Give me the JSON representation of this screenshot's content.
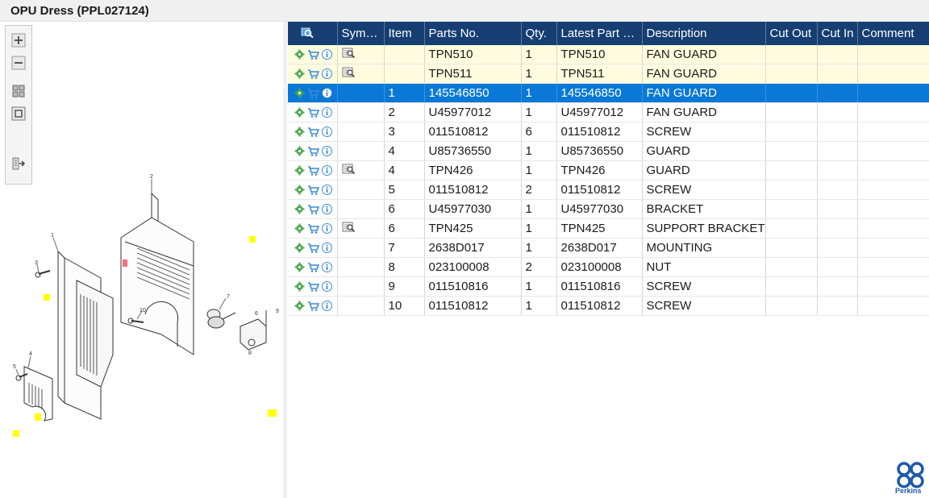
{
  "window": {
    "title": "OPU Dress (PPL027124)"
  },
  "viewer_toolbar": {
    "buttons": [
      "zoom-in-icon",
      "zoom-out-icon",
      "fit-all-icon",
      "fit-window-icon",
      "export-icon"
    ]
  },
  "colors": {
    "header_bg": "#163e72",
    "selected_row": "#0a78d6",
    "highlight_row": "#fdfcdf",
    "gear_icon": "#4aa64a",
    "cart_icon": "#3a8ad6",
    "brand": "#1e5aa8"
  },
  "table": {
    "columns": [
      "Symb…",
      "Item",
      "Parts No.",
      "Qty.",
      "Latest Part No.",
      "Description",
      "Cut Out",
      "Cut In",
      "Comment"
    ],
    "rows": [
      {
        "symbol": true,
        "item": "",
        "parts_no": "TPN510",
        "qty": "1",
        "latest": "TPN510",
        "description": "FAN GUARD",
        "cut_out": "",
        "cut_in": "",
        "comment": "",
        "state": "highlight"
      },
      {
        "symbol": true,
        "item": "",
        "parts_no": "TPN511",
        "qty": "1",
        "latest": "TPN511",
        "description": "FAN GUARD",
        "cut_out": "",
        "cut_in": "",
        "comment": "",
        "state": "highlight"
      },
      {
        "symbol": false,
        "item": "1",
        "parts_no": "145546850",
        "qty": "1",
        "latest": "145546850",
        "description": "FAN GUARD",
        "cut_out": "",
        "cut_in": "",
        "comment": "",
        "state": "selected"
      },
      {
        "symbol": false,
        "item": "2",
        "parts_no": "U45977012",
        "qty": "1",
        "latest": "U45977012",
        "description": "FAN GUARD",
        "cut_out": "",
        "cut_in": "",
        "comment": "",
        "state": "normal"
      },
      {
        "symbol": false,
        "item": "3",
        "parts_no": "011510812",
        "qty": "6",
        "latest": "011510812",
        "description": "SCREW",
        "cut_out": "",
        "cut_in": "",
        "comment": "",
        "state": "normal"
      },
      {
        "symbol": false,
        "item": "4",
        "parts_no": "U85736550",
        "qty": "1",
        "latest": "U85736550",
        "description": "GUARD",
        "cut_out": "",
        "cut_in": "",
        "comment": "",
        "state": "normal"
      },
      {
        "symbol": true,
        "item": "4",
        "parts_no": "TPN426",
        "qty": "1",
        "latest": "TPN426",
        "description": "GUARD",
        "cut_out": "",
        "cut_in": "",
        "comment": "",
        "state": "normal"
      },
      {
        "symbol": false,
        "item": "5",
        "parts_no": "011510812",
        "qty": "2",
        "latest": "011510812",
        "description": "SCREW",
        "cut_out": "",
        "cut_in": "",
        "comment": "",
        "state": "normal"
      },
      {
        "symbol": false,
        "item": "6",
        "parts_no": "U45977030",
        "qty": "1",
        "latest": "U45977030",
        "description": "BRACKET",
        "cut_out": "",
        "cut_in": "",
        "comment": "",
        "state": "normal"
      },
      {
        "symbol": true,
        "item": "6",
        "parts_no": "TPN425",
        "qty": "1",
        "latest": "TPN425",
        "description": "SUPPORT BRACKET",
        "cut_out": "",
        "cut_in": "",
        "comment": "",
        "state": "normal"
      },
      {
        "symbol": false,
        "item": "7",
        "parts_no": "2638D017",
        "qty": "1",
        "latest": "2638D017",
        "description": "MOUNTING",
        "cut_out": "",
        "cut_in": "",
        "comment": "",
        "state": "normal"
      },
      {
        "symbol": false,
        "item": "8",
        "parts_no": "023100008",
        "qty": "2",
        "latest": "023100008",
        "description": "NUT",
        "cut_out": "",
        "cut_in": "",
        "comment": "",
        "state": "normal"
      },
      {
        "symbol": false,
        "item": "9",
        "parts_no": "011510816",
        "qty": "1",
        "latest": "011510816",
        "description": "SCREW",
        "cut_out": "",
        "cut_in": "",
        "comment": "",
        "state": "normal"
      },
      {
        "symbol": false,
        "item": "10",
        "parts_no": "011510812",
        "qty": "1",
        "latest": "011510812",
        "description": "SCREW",
        "cut_out": "",
        "cut_in": "",
        "comment": "",
        "state": "normal"
      }
    ]
  },
  "drawing": {
    "callouts": [
      "2",
      "1",
      "3",
      "7",
      "10",
      "6",
      "9",
      "8",
      "4",
      "5"
    ]
  },
  "logo": {
    "text": "Perkins"
  }
}
